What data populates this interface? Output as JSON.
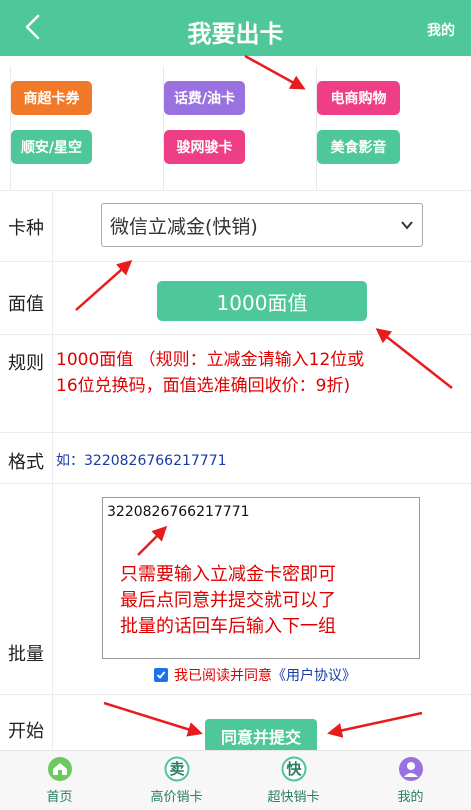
{
  "header": {
    "title": "我要出卡",
    "mine_label": "我的"
  },
  "categories": [
    {
      "label": "商超卡券",
      "color": "#f07a2a"
    },
    {
      "label": "话费/油卡",
      "color": "#9a72e0"
    },
    {
      "label": "电商购物",
      "color": "#ee3f86"
    },
    {
      "label": "顺安/星空",
      "color": "#4ec79a"
    },
    {
      "label": "骏网骏卡",
      "color": "#ee3f86"
    },
    {
      "label": "美食影音",
      "color": "#4ec79a"
    }
  ],
  "form": {
    "card_type_label": "卡种",
    "card_type_value": "微信立减金(快销)",
    "face_value_label": "面值",
    "face_value": "1000面值",
    "rule_label": "规则",
    "rule_text": "1000面值 （规则：立减金请输入12位或16位兑换码，面值选准确回收价：9折)",
    "format_label": "格式",
    "format_text": "如：3220826766217771",
    "batch_label": "批量",
    "batch_value": "3220826766217771",
    "batch_note_lines": [
      "只需要输入立减金卡密即可",
      "最后点同意并提交就可以了",
      "批量的话回车后输入下一组"
    ],
    "agree_text": "我已阅读并同意",
    "agree_link": "《用户协议》",
    "start_label": "开始",
    "submit_label": "同意并提交"
  },
  "tabbar": [
    {
      "label": "首页",
      "icon": "home-icon",
      "glyph": ""
    },
    {
      "label": "高价销卡",
      "icon": "sell-icon",
      "glyph": "卖"
    },
    {
      "label": "超快销卡",
      "icon": "fast-icon",
      "glyph": "快"
    },
    {
      "label": "我的",
      "icon": "user-icon",
      "glyph": ""
    }
  ],
  "colors": {
    "brand": "#4ec79a",
    "annotation_red": "#e00000",
    "link_blue": "#1a3aa6"
  }
}
